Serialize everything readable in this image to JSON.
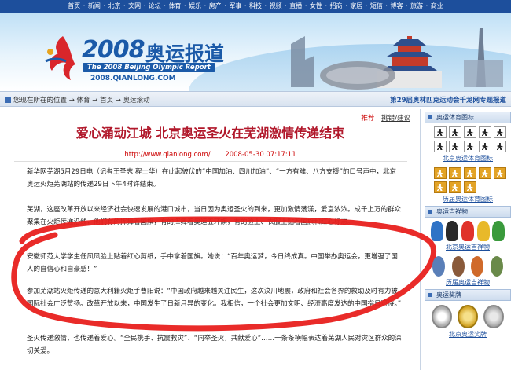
{
  "topnav": {
    "items": [
      "首页",
      "新闻",
      "北京",
      "文网",
      "论坛",
      "体育",
      "娱乐",
      "房产",
      "军事",
      "科技",
      "视频",
      "直播",
      "女性",
      "招商",
      "家居",
      "短信",
      "博客",
      "旅游",
      "商业"
    ]
  },
  "banner": {
    "logo_number": "2008",
    "logo_title": "奥运报道",
    "logo_english": "The 2008 Beijing Olympic Report",
    "logo_url": "2008.QIANLONG.COM"
  },
  "breadcrumb": {
    "label": "您现在所在的位置",
    "items": [
      "体育",
      "首页",
      "奥运滚动"
    ],
    "right_title": "第29届奥林匹克运动会千龙网专题报道"
  },
  "article": {
    "recommend_link": "推荐",
    "error_link": "挑错/建议",
    "headline": "爱心涌动江城  北京奥运圣火在芜湖激情传递结束",
    "source_url": "http://www.qianlong.com/",
    "datetime": "2008-05-30 07:17:11",
    "paragraphs": [
      "新华网芜湖5月29日电（记者王圣志  程士华）在此起彼伏的“中国加油、四川加油”、“一方有难、八方支援”的口号声中，北京奥运火炬芜湖站的传递29日下午4时许结束。",
      "芜湖，这座改革开放以来经济社会快速发展的港口城市，当日因为奥运圣火的到来，更加激情荡漾，爱意浓浓。成千上万的群众聚集在火炬传递沿线，他们有的挥舞着国旗，有的挥舞着奥运五环旗，有的脸上、衣服上贴着国旗和红心标志。",
      "安徽师范大学学生任凤凤脸上贴着红心剪纸，手中拿着国旗。她说：“百年奥运梦，今日终成真。中国举办奥运会，更增强了国人的自信心和自豪感！”",
      "参加芜湖站火炬传递的意大利籍火炬手曹阳说：“中国政府越来越关注民生，这次汶川地震，政府和社会各界的救助及时有力被国际社会广泛赞扬。改革开放以来，中国发生了日新月异的变化。我相信，一个社会更加文明、经济高度发达的中国指日可待。”",
      "圣火传递激情，也传递着爱心。“全民携手、抗震救灾”、“同举圣火，共献爱心”……一条条横幅表达着芜湖人民对灾区群众的深切关爱。"
    ]
  },
  "sidebar": {
    "sports_icons_title": "奥运体育图标",
    "sports_icons_caption": "北京奥运体育图标",
    "history_icons_caption": "历届奥运体育图标",
    "mascot_title": "奥运吉祥物",
    "mascot_caption": "北京奥运吉祥物",
    "history_mascot_caption": "历届奥运吉祥物",
    "medal_title": "奥运奖牌",
    "medal_caption": "北京奥运奖牌"
  },
  "colors": {
    "nav_blue": "#1d4f9c",
    "headline_red": "#b1182b",
    "annotation_red": "#e8201e"
  }
}
